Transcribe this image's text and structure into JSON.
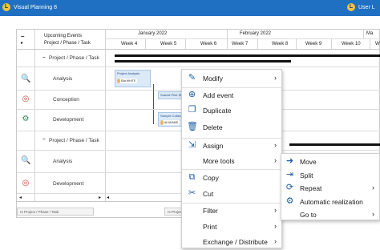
{
  "app": {
    "title": "Visual Planning 8",
    "user_label": "User L",
    "logo_letter": "L"
  },
  "header": {
    "collapse_symbol": "–",
    "expand_symbol": "▸",
    "upcoming_events": "Upcoming Events",
    "column_label": "Project / Phase / Task",
    "months": [
      "January 2022",
      "February 2022",
      "Ma"
    ],
    "weeks": [
      "Week 4",
      "Week 5",
      "Week 6",
      "Week 7",
      "Week 8",
      "Week 9",
      "Week 10",
      "W"
    ]
  },
  "rows": {
    "group1": "Project / Phase / Task",
    "analysis1": "Analysis",
    "conception": "Conception",
    "development": "Development",
    "group2": "Project / Phase / Task",
    "analysis2": "Analysis",
    "development2": "Development"
  },
  "tasks": {
    "project_analysis": "Project Analysis",
    "project_analysis_person": "Ella WHITE",
    "submit_pilot": "Submit Pilot Sl...",
    "sample_collect": "Sample Collect...",
    "sample_collect_person": "Ali ADAMS"
  },
  "footer": {
    "tab1": "rs Project / Phase / Task",
    "tab2": "rs Project / Phase"
  },
  "context_menu": {
    "modify": "Modify",
    "add_event": "Add event",
    "duplicate": "Duplicate",
    "delete": "Delete",
    "assign": "Assign",
    "more_tools": "More tools",
    "copy": "Copy",
    "cut": "Cut",
    "filter": "Filter",
    "print": "Print",
    "exchange": "Exchange / Distribute"
  },
  "submenu": {
    "move": "Move",
    "split": "Split",
    "repeat": "Repeat",
    "automatic_realization": "Automatic realization",
    "go_to": "Go to"
  },
  "colors": {
    "titlebar": "#1f6fc2",
    "accent": "#1f5fa6",
    "task_fill": "#dce9f7"
  }
}
